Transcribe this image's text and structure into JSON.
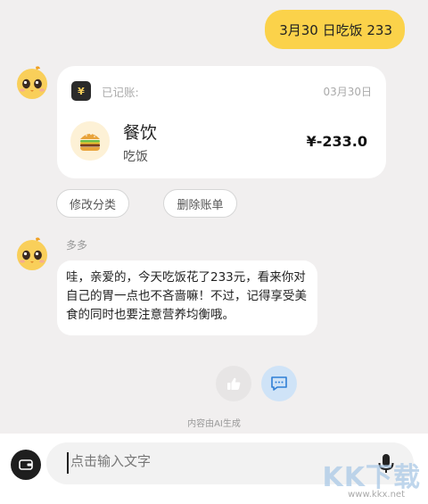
{
  "user_message": "3月30 日吃饭 233",
  "bill_card": {
    "recorded_label": "已记账:",
    "date": "03月30日",
    "icon_glyph": "¥",
    "category_icon": "hamburger-icon",
    "category": "餐饮",
    "note": "吃饭",
    "amount": "¥-233.0"
  },
  "actions": {
    "edit_category": "修改分类",
    "delete_bill": "删除账单"
  },
  "bot": {
    "name": "多多",
    "reply": "哇，亲爱的，今天吃饭花了233元，看来你对自己的胃一点也不吝啬嘛！不过，记得享受美食的同时也要注意营养均衡哦。"
  },
  "reply_actions": [
    "thumbs-up-icon",
    "message-icon"
  ],
  "disclaimer": "内容由AI生成",
  "input": {
    "placeholder": "点击输入文字",
    "left_icon": "wallet-icon",
    "right_icon": "microphone-icon"
  },
  "watermark": {
    "text": "KK下载",
    "url": "www.kkx.net"
  },
  "colors": {
    "background": "#f1efef",
    "user_bubble": "#fbd24a",
    "accent_blue": "#cfe3f7"
  }
}
